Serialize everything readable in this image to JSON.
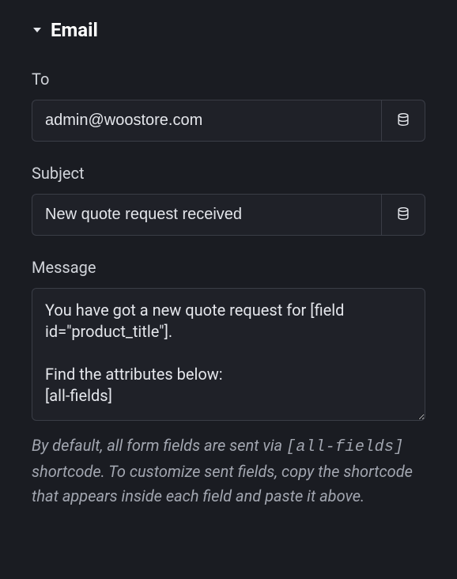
{
  "section": {
    "title": "Email",
    "expanded": true
  },
  "fields": {
    "to": {
      "label": "To",
      "value": "admin@woostore.com"
    },
    "subject": {
      "label": "Subject",
      "value": "New quote request received"
    },
    "message": {
      "label": "Message",
      "value": "You have got a new quote request for [field id=\"product_title\"].\n\nFind the attributes below:\n[all-fields]"
    }
  },
  "help": {
    "prefix": "By default, all form fields are sent via ",
    "code": "[all-fields]",
    "suffix": " shortcode. To customize sent fields, copy the shortcode that appears inside each field and paste it above."
  },
  "icons": {
    "database": "database-icon",
    "caret": "caret-down-icon"
  }
}
